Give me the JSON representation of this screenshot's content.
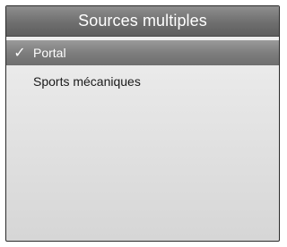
{
  "header": {
    "title": "Sources multiples"
  },
  "list": {
    "items": [
      {
        "label": "Portal",
        "selected": true,
        "check_glyph": "✓"
      },
      {
        "label": "Sports mécaniques",
        "selected": false
      }
    ]
  },
  "colors": {
    "titlebar": "#6f6f6f",
    "selected_row": "#7e7e7e",
    "background": "#e6e6e6",
    "text": "#1a1a1a"
  },
  "icons": {
    "check": "checkmark-icon"
  }
}
